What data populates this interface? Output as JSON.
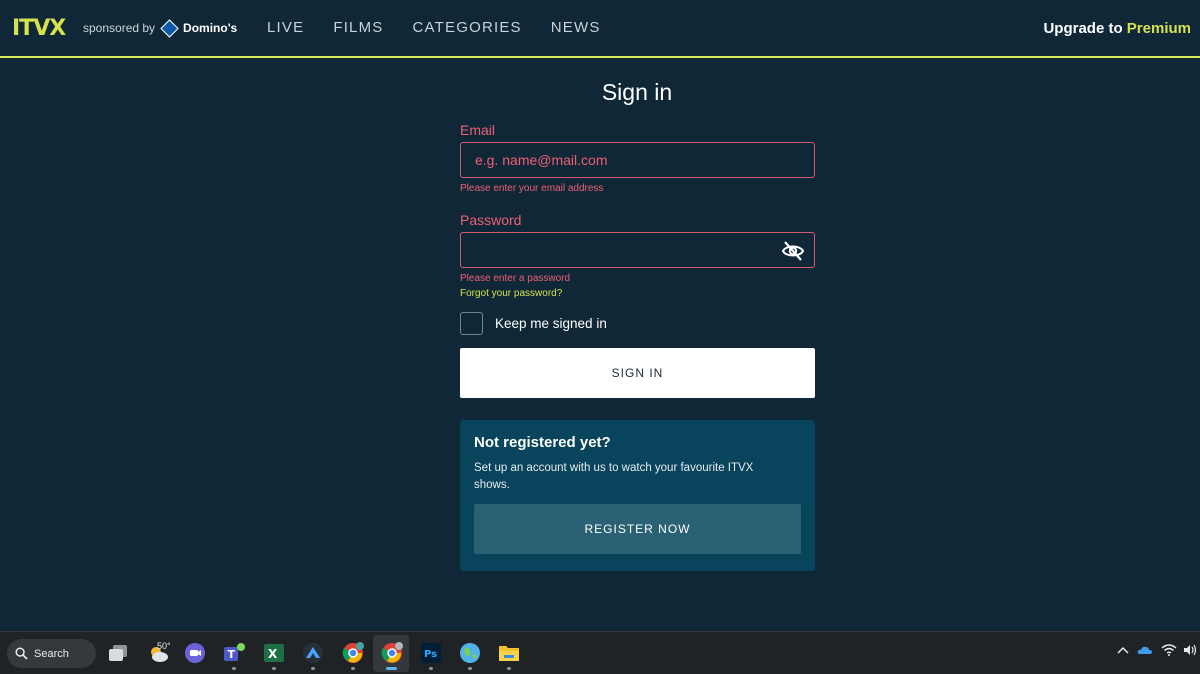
{
  "header": {
    "logo": "ITVX",
    "sponsor_prefix": "sponsored by",
    "sponsor_brand": "Domino's",
    "nav": [
      "LIVE",
      "FILMS",
      "CATEGORIES",
      "NEWS"
    ],
    "upgrade_prefix": "Upgrade to",
    "upgrade_highlight": "Premium"
  },
  "signin": {
    "title": "Sign in",
    "email_label": "Email",
    "email_placeholder": "e.g. name@mail.com",
    "email_value": "",
    "email_error": "Please enter your email address",
    "password_label": "Password",
    "password_value": "",
    "password_error": "Please enter a password",
    "forgot": "Forgot your password?",
    "keep_signed_in": "Keep me signed in",
    "signin_button": "SIGN IN"
  },
  "register": {
    "title": "Not registered yet?",
    "text": "Set up an account with us to watch your favourite ITVX shows.",
    "button": "REGISTER NOW"
  },
  "taskbar": {
    "search_label": "Search",
    "weather_temp": "50°"
  },
  "colors": {
    "background": "#0f2736",
    "accent_yellow": "#d6e14e",
    "error_pink": "#ee5f75",
    "register_card": "#08445b",
    "register_button": "#2b6175"
  }
}
